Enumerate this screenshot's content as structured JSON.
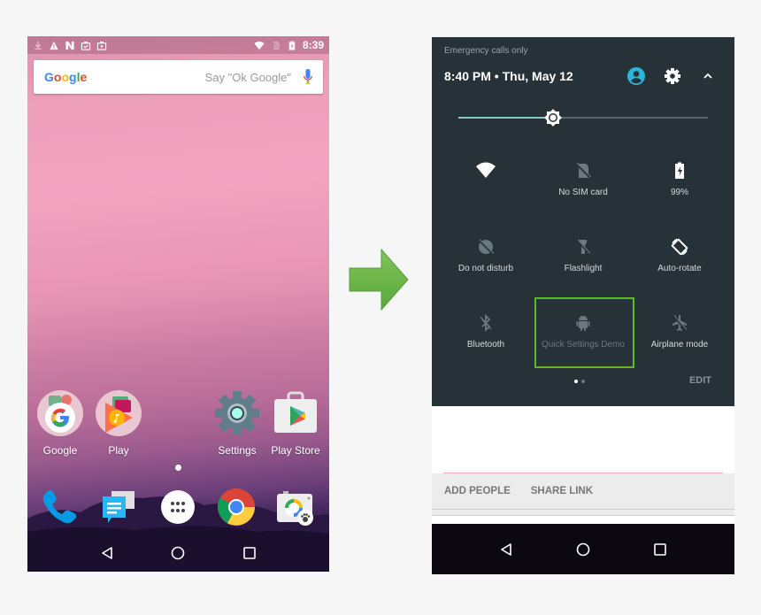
{
  "home_screen": {
    "status_bar": {
      "left_icons": [
        "download-icon",
        "warning-icon",
        "n-icon",
        "photo-check-icon",
        "photo-play-icon"
      ],
      "right_icons": [
        "wifi-icon",
        "no-sim-icon",
        "battery-charging-icon"
      ],
      "time": "8:39"
    },
    "search": {
      "logo": [
        "G",
        "o",
        "o",
        "g",
        "l",
        "e"
      ],
      "hint": "Say \"Ok Google\""
    },
    "apps": [
      {
        "label": "Google"
      },
      {
        "label": "Play"
      },
      {
        "label": "Settings"
      },
      {
        "label": "Play Store"
      }
    ],
    "dock": [
      "phone-icon",
      "messages-icon",
      "app-drawer-icon",
      "chrome-icon",
      "camera-icon"
    ]
  },
  "quick_settings": {
    "emergency_text": "Emergency calls only",
    "datetime": "8:40 PM  •  Thu, May 12",
    "brightness_level": 0.38,
    "tiles": [
      {
        "label": "",
        "icon": "wifi-icon",
        "active": true
      },
      {
        "label": "No SIM card",
        "icon": "no-sim-icon",
        "active": false
      },
      {
        "label": "99%",
        "icon": "battery-charging-icon",
        "active": true
      },
      {
        "label": "Do not disturb",
        "icon": "dnd-off-icon",
        "active": false
      },
      {
        "label": "Flashlight",
        "icon": "flashlight-off-icon",
        "active": false
      },
      {
        "label": "Auto-rotate",
        "icon": "auto-rotate-icon",
        "active": true
      },
      {
        "label": "Bluetooth",
        "icon": "bluetooth-off-icon",
        "active": false
      },
      {
        "label": "Quick Settings Demo",
        "icon": "android-icon",
        "active": false
      },
      {
        "label": "Airplane mode",
        "icon": "airplane-off-icon",
        "active": false
      }
    ],
    "edit_label": "EDIT",
    "pages": 2,
    "current_page": 1
  },
  "background_app": {
    "actions": [
      "ADD PEOPLE",
      "SHARE LINK"
    ]
  },
  "colors": {
    "highlight": "#5dbb25",
    "arrow": "#6ab547",
    "qs_background": "#263238",
    "brightness_accent": "#80cbc4",
    "avatar": "#29b6d8"
  }
}
